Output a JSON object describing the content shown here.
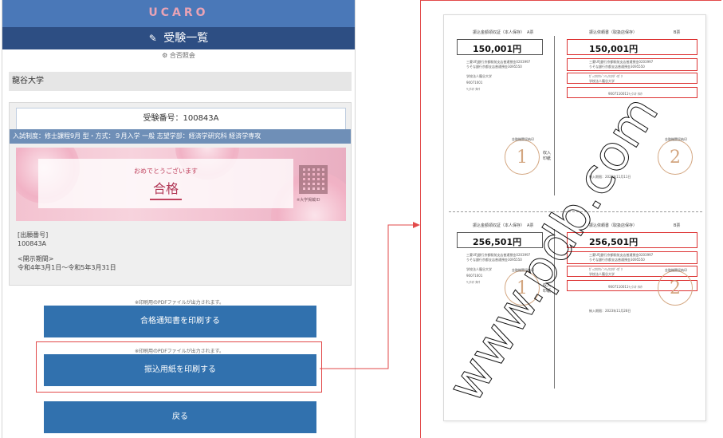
{
  "app": {
    "brand": "UCARO"
  },
  "header": {
    "title": "受験一覧",
    "subtitle": "合否照会"
  },
  "university": "龍谷大学",
  "exam": {
    "number_line": "受験番号：100843A",
    "meta": "入試制度：修士課程9月  型・方式：９月入学 一般  志望学部：経済学研究科 経済学専攻"
  },
  "banner": {
    "congrats": "おめでとうございます",
    "result": "合格",
    "qr_caption": "※大学掲載ID"
  },
  "info": {
    "label_number": "[出願番号]",
    "number": "100843A",
    "label_period": "<開示期間>",
    "period": "令和4年3月1日～令和5年3月31日"
  },
  "actions": {
    "note_1": "※印刷用のPDFファイルが出力されます。",
    "print_notice": "合格通知書を印刷する",
    "note_2": "※印刷用のPDFファイルが出力されます。",
    "print_slip": "振込用紙を印刷する",
    "back": "戻る"
  },
  "document": {
    "watermark": "www.pdb.com",
    "slips": [
      {
        "head_left": "振込金額領収証（本人保存）",
        "head_left_tag": "A票",
        "head_right": "振込依頼書（取扱店保存）",
        "head_right_tag": "B票",
        "amount_left": "150,001円",
        "amount_right": "150,001円",
        "bank_line_1": "三菱UFJ銀行京都駅前支店普通預金0203997",
        "bank_line_2": "りそな銀行京都支店普通預金3095550",
        "payee": "学校法人龍谷大学",
        "payee_kana": "ｶﾞｯｺｳﾎｳｼﾞﾝﾘｭｳｺｸﾀﾞｲｶﾞｸ",
        "payer_number": "90071001",
        "payer_kana": "ﾘｭｳｺｸ ﾀﾛｳ",
        "payer_code": "9007110011ﾘｭｳｺｸ ﾀﾛｳ",
        "deadline": "納入期限：2023年11月11日",
        "stamp_left": "1",
        "stamp_right": "2",
        "stamp_caption": "金融機関収納印",
        "receipt_label": "収入印紙"
      },
      {
        "head_left": "振込金額領収証（本人保存）",
        "head_left_tag": "A票",
        "head_right": "振込依頼書（取扱店保存）",
        "head_right_tag": "B票",
        "amount_left": "256,501円",
        "amount_right": "256,501円",
        "bank_line_1": "三菱UFJ銀行京都駅前支店普通預金0203997",
        "bank_line_2": "りそな銀行京都支店普通預金3095550",
        "payee": "学校法人龍谷大学",
        "payee_kana": "ｶﾞｯｺｳﾎｳｼﾞﾝﾘｭｳｺｸﾀﾞｲｶﾞｸ",
        "payer_number": "90071001",
        "payer_kana": "ﾘｭｳｺｸ ﾀﾛｳ",
        "payer_code": "9007110011ﾘｭｳｺｸ ﾀﾛｳ",
        "deadline": "納入期限：2023年11月28日",
        "stamp_left": "1",
        "stamp_right": "2",
        "stamp_caption": "金融機関収納印",
        "receipt_label": "収入印紙"
      }
    ]
  },
  "colors": {
    "accent": "#3171ae",
    "header": "#2d4e83",
    "highlight": "#e24a4a"
  }
}
